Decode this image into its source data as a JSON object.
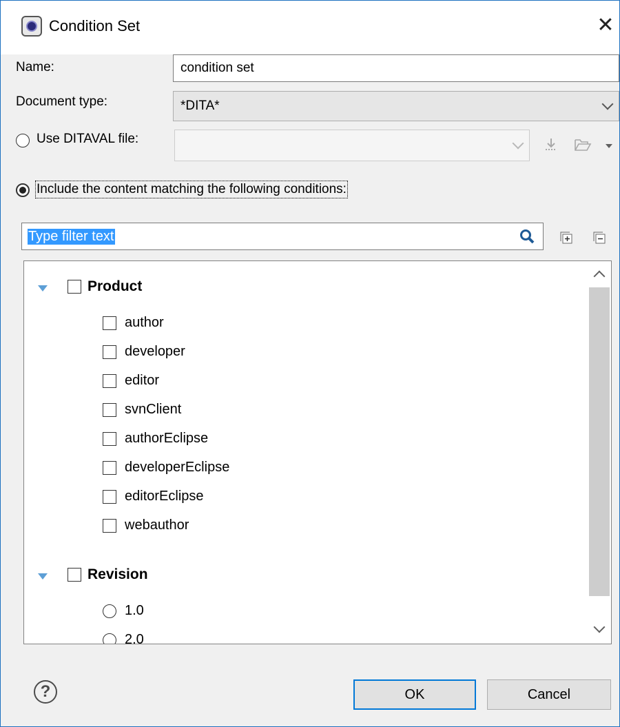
{
  "window": {
    "title": "Condition Set",
    "close_glyph": "✕"
  },
  "form": {
    "name_label": "Name:",
    "name_value": "condition set",
    "doctype_label": "Document type:",
    "doctype_value": "*DITA*",
    "ditaval_label": "Use DITAVAL file:",
    "ditaval_value": "",
    "include_label": "Include the content matching the following conditions:"
  },
  "filter": {
    "placeholder": "Type filter text"
  },
  "tree": {
    "groups": [
      {
        "label": "Product",
        "kind": "checkbox",
        "items": [
          "author",
          "developer",
          "editor",
          "svnClient",
          "authorEclipse",
          "developerEclipse",
          "editorEclipse",
          "webauthor"
        ]
      },
      {
        "label": "Revision",
        "kind": "radio",
        "items": [
          "1.0",
          "2.0"
        ]
      }
    ]
  },
  "buttons": {
    "ok": "OK",
    "cancel": "Cancel",
    "help": "?"
  },
  "icons": {
    "app": "oxygen-app-icon",
    "download": "download-icon",
    "browse": "folder-open-icon",
    "search": "search-icon",
    "expand_all": "expand-all-icon",
    "collapse_all": "collapse-all-icon",
    "help": "help-icon"
  },
  "colors": {
    "accent": "#0078d7",
    "selection": "#3399ff",
    "tree_arrow": "#5d9fd6"
  }
}
